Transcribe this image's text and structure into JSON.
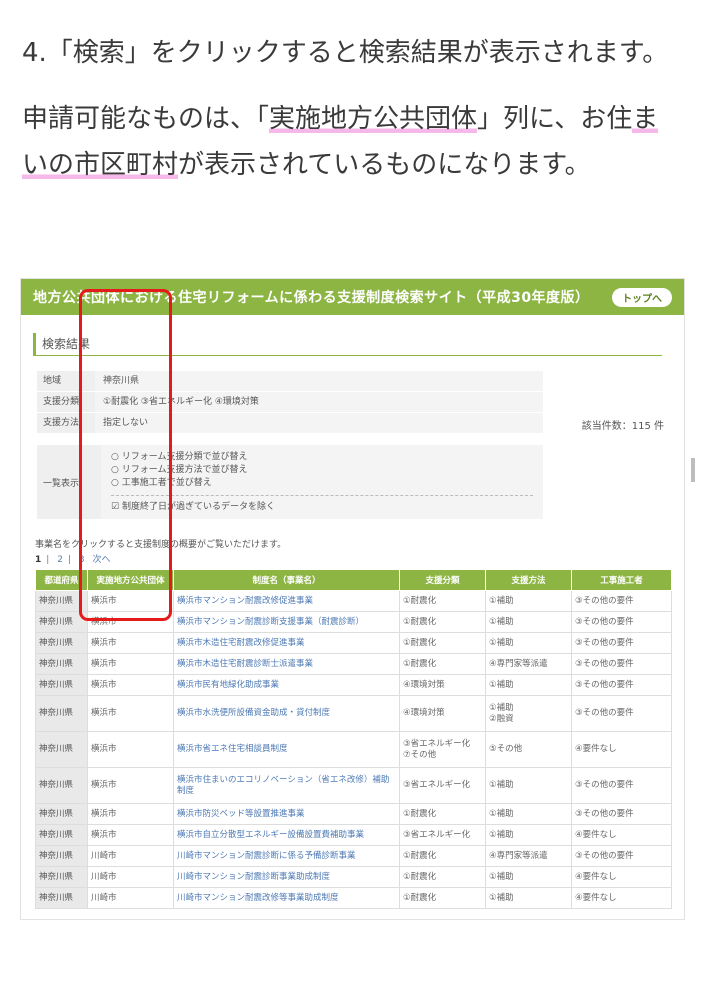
{
  "article": {
    "step": "4.「検索」をクリックすると検索結果が表示されます。",
    "para2_a": "申請可能なものは、「",
    "para2_hl1": "実施地方公共団体",
    "para2_b": "」列に、お住",
    "para2_hl2": "まいの市区町村",
    "para2_c": "が表示されているものになります。"
  },
  "site": {
    "banner_title": "地方公共団体における住宅リフォームに係わる支援制度検索サイト（平成30年度版）",
    "top_button": "トップへ",
    "section_title": "検索結果",
    "conditions": [
      {
        "label": "地域",
        "value": "神奈川県"
      },
      {
        "label": "支援分類",
        "value": "①耐震化 ③省エネルギー化 ④環境対策"
      },
      {
        "label": "支援方法",
        "value": "指定しない"
      }
    ],
    "result_count": "該当件数：115 件",
    "display_label": "一覧表示",
    "sort_options": [
      "リフォーム支援分類で並び替え",
      "リフォーム支援方法で並び替え",
      "工事施工者で並び替え"
    ],
    "exclude_label": "制度終了日が過ぎているデータを除く",
    "note": "事業名をクリックすると支援制度の概要がご覧いただけます。",
    "pages": [
      "1",
      "2",
      "3",
      "次へ"
    ]
  },
  "table": {
    "headers": [
      "都道府県",
      "実施地方公共団体",
      "制度名（事業名）",
      "支援分類",
      "支援方法",
      "工事施工者"
    ],
    "rows": [
      [
        "神奈川県",
        "横浜市",
        "横浜市マンション耐震改修促進事業",
        "①耐震化",
        "①補助",
        "③その他の要件"
      ],
      [
        "神奈川県",
        "横浜市",
        "横浜市マンション耐震診断支援事業（耐震診断）",
        "①耐震化",
        "①補助",
        "③その他の要件"
      ],
      [
        "神奈川県",
        "横浜市",
        "横浜市木造住宅耐震改修促進事業",
        "①耐震化",
        "①補助",
        "③その他の要件"
      ],
      [
        "神奈川県",
        "横浜市",
        "横浜市木造住宅耐震診断士派遣事業",
        "①耐震化",
        "④専門家等派遣",
        "③その他の要件"
      ],
      [
        "神奈川県",
        "横浜市",
        "横浜市民有地緑化助成事業",
        "④環境対策",
        "①補助",
        "③その他の要件"
      ],
      [
        "神奈川県",
        "横浜市",
        "横浜市水洗便所設備資金助成・貸付制度",
        "④環境対策",
        "①補助\n②融資",
        "③その他の要件"
      ],
      [
        "神奈川県",
        "横浜市",
        "横浜市省エネ住宅相談員制度",
        "③省エネルギー化\n⑦その他",
        "⑤その他",
        "④要件なし"
      ],
      [
        "神奈川県",
        "横浜市",
        "横浜市住まいのエコリノベーション（省エネ改修）補助制度",
        "③省エネルギー化",
        "①補助",
        "③その他の要件"
      ],
      [
        "神奈川県",
        "横浜市",
        "横浜市防災ベッド等設置推進事業",
        "①耐震化",
        "①補助",
        "③その他の要件"
      ],
      [
        "神奈川県",
        "横浜市",
        "横浜市自立分散型エネルギー設備設置費補助事業",
        "③省エネルギー化",
        "①補助",
        "④要件なし"
      ],
      [
        "神奈川県",
        "川崎市",
        "川崎市マンション耐震診断に係る予備診断事業",
        "①耐震化",
        "④専門家等派遣",
        "③その他の要件"
      ],
      [
        "神奈川県",
        "川崎市",
        "川崎市マンション耐震診断事業助成制度",
        "①耐震化",
        "①補助",
        "④要件なし"
      ],
      [
        "神奈川県",
        "川崎市",
        "川崎市マンション耐震改修等事業助成制度",
        "①耐震化",
        "①補助",
        "④要件なし"
      ]
    ]
  }
}
